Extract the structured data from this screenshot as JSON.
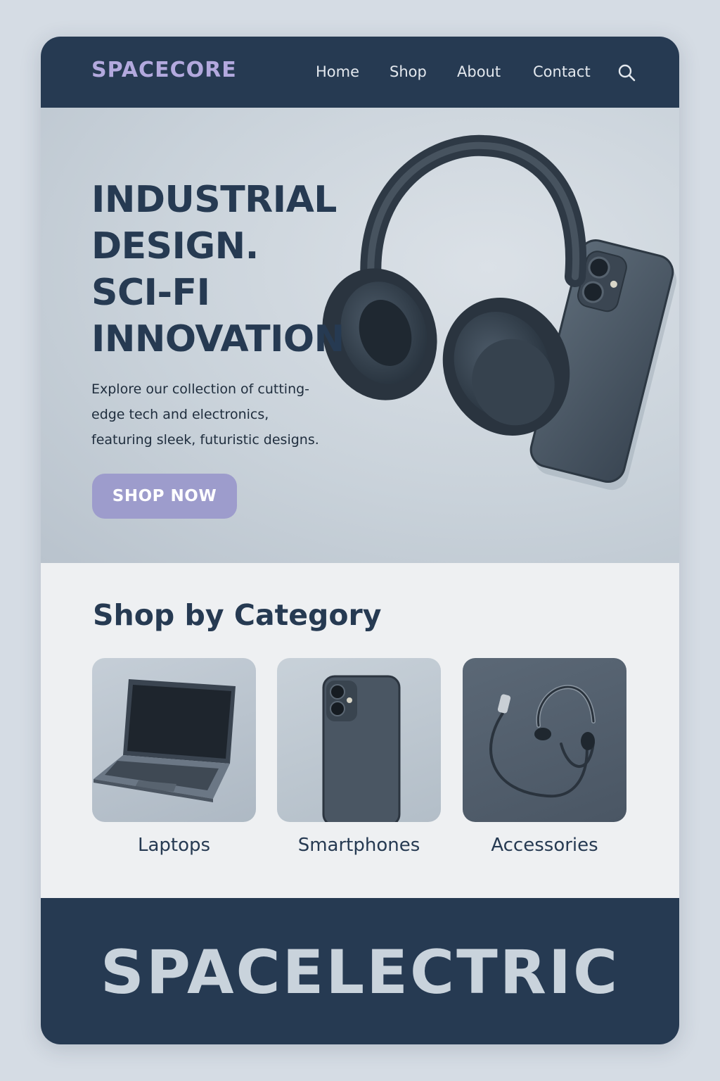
{
  "header": {
    "logo": "SPACECORE",
    "nav": [
      {
        "label": "Home"
      },
      {
        "label": "Shop"
      },
      {
        "label": "About"
      },
      {
        "label": "Contact"
      }
    ],
    "search_icon": "search-icon"
  },
  "hero": {
    "title_lines": [
      "INDUSTRIAL",
      "DESIGN.",
      "SCI-FI",
      "INNOVATION"
    ],
    "subtitle_lines": [
      "Explore our collection of cutting-",
      "edge tech and electronics,",
      "featuring sleek, futuristic designs."
    ],
    "cta_label": "SHOP NOW",
    "image_subjects": [
      "headphones",
      "smartphone"
    ]
  },
  "categories": {
    "title": "Shop by Category",
    "items": [
      {
        "label": "Laptops",
        "icon": "laptop-image"
      },
      {
        "label": "Smartphones",
        "icon": "smartphone-image"
      },
      {
        "label": "Accessories",
        "icon": "earphones-image"
      }
    ]
  },
  "footer": {
    "brand": "SPACELECTRIC"
  },
  "colors": {
    "page_bg": "#d5dce4",
    "navy": "#263a52",
    "logo_lavender": "#b3a9de",
    "button_lavender": "#9d9ccc",
    "section_bg": "#eef0f2",
    "footer_text": "#c9d3dc"
  }
}
